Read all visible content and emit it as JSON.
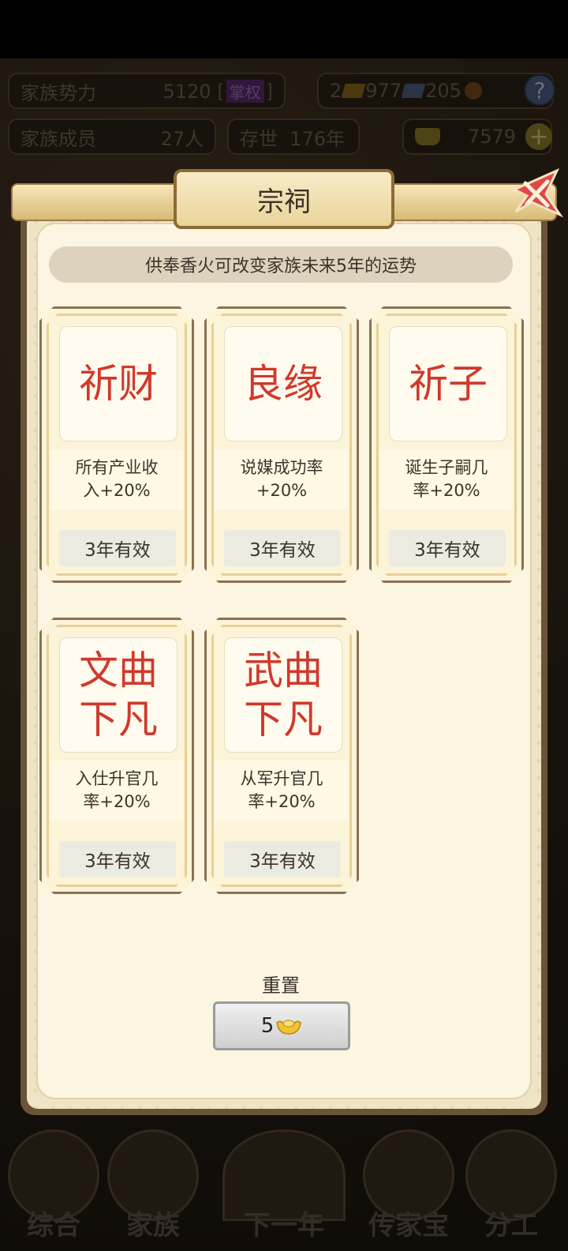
{
  "topbar": {
    "family_power_label": "家族势力",
    "family_power_value": "5120",
    "family_power_badge": "掌权",
    "family_members_label": "家族成员",
    "family_members_value": "27人",
    "existence_label": "存世",
    "existence_value": "176年",
    "resource_a": "2",
    "resource_b": "977",
    "resource_c": "205",
    "gold_value": "7579",
    "help_symbol": "?"
  },
  "modal": {
    "title": "宗祠",
    "subtitle": "供奉香火可改变家族未来5年的运势",
    "cards": [
      {
        "face": "祈财",
        "desc_line1": "所有产业收",
        "desc_line2": "入+20%",
        "duration": "3年有效"
      },
      {
        "face": "良缘",
        "desc_line1": "说媒成功率",
        "desc_line2": "+20%",
        "duration": "3年有效"
      },
      {
        "face": "祈子",
        "desc_line1": "诞生子嗣几",
        "desc_line2": "率+20%",
        "duration": "3年有效"
      },
      {
        "face_line1": "文曲",
        "face_line2": "下凡",
        "desc_line1": "入仕升官几",
        "desc_line2": "率+20%",
        "duration": "3年有效"
      },
      {
        "face_line1": "武曲",
        "face_line2": "下凡",
        "desc_line1": "从军升官几",
        "desc_line2": "率+20%",
        "duration": "3年有效"
      }
    ],
    "reset_label": "重置",
    "reset_cost": "5",
    "cost_icon": "gold-ingot-icon"
  },
  "nav": {
    "items": [
      "综合",
      "家族",
      "下一年",
      "传家宝",
      "分工"
    ]
  },
  "colors": {
    "accent_red": "#d0392b",
    "panel_bg": "#fbf5e2",
    "frame_brown": "#6a5438"
  }
}
